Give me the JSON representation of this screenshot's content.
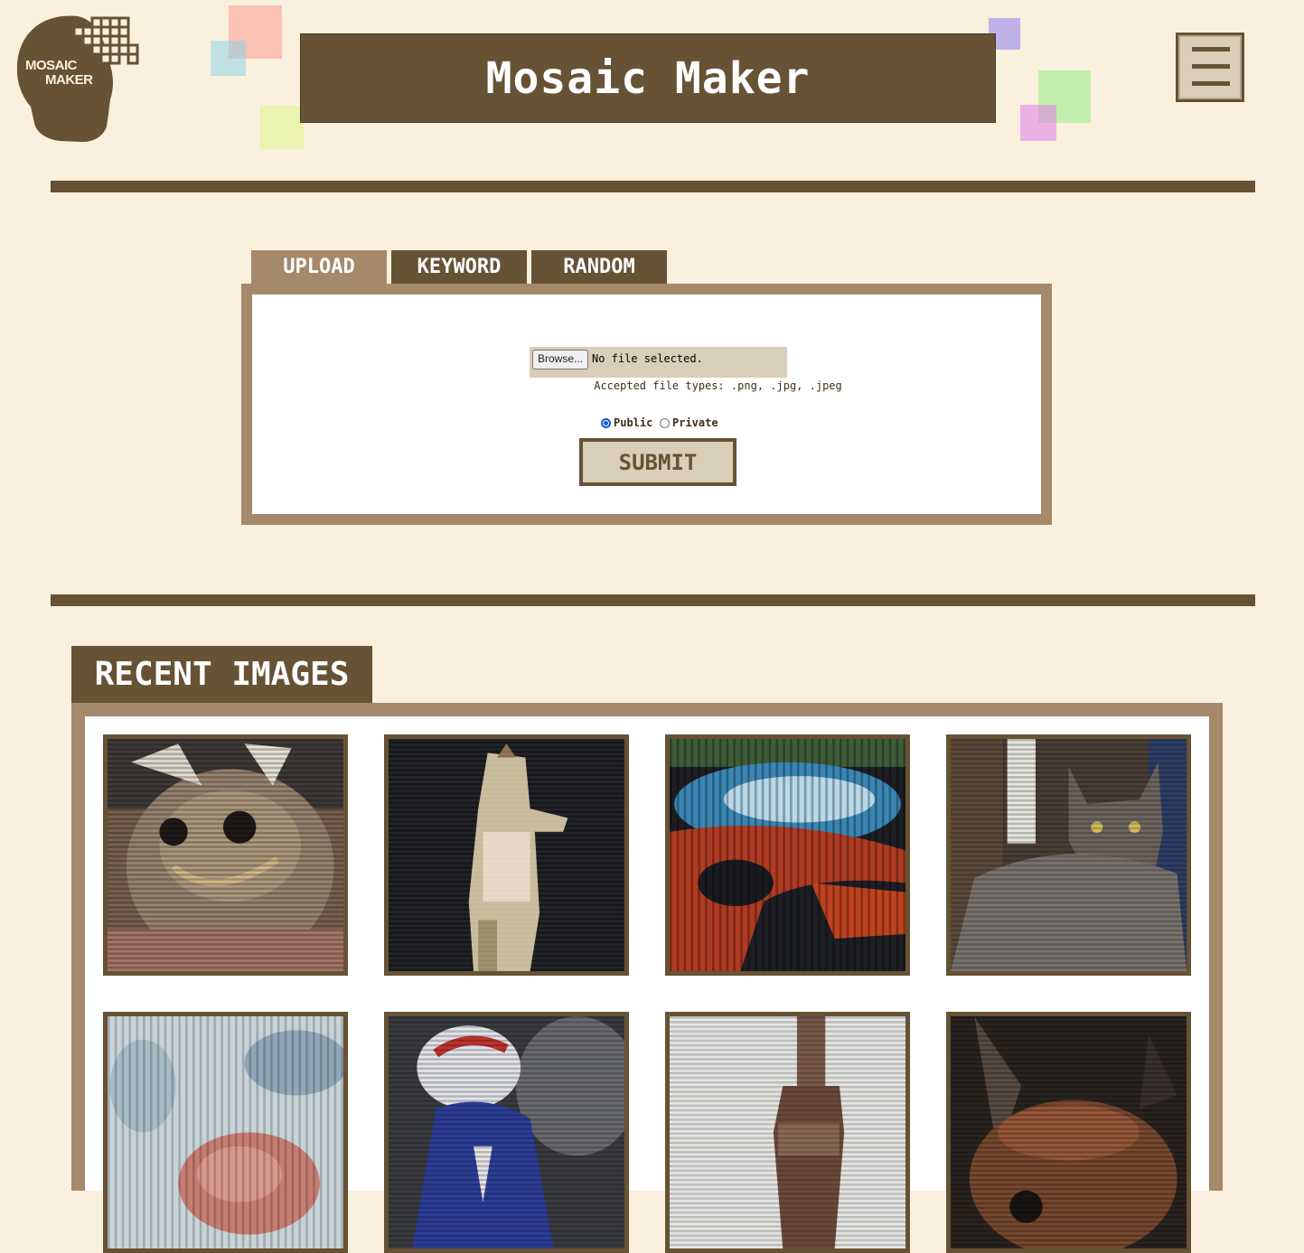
{
  "brand": {
    "logo_line1": "MOSAIC",
    "logo_line2": "MAKER",
    "title": "Mosaic Maker"
  },
  "nav": {
    "menu_icon": "hamburger-menu-icon"
  },
  "upload_section": {
    "tabs": [
      {
        "label": "UPLOAD",
        "active": true
      },
      {
        "label": "KEYWORD",
        "active": false
      },
      {
        "label": "RANDOM",
        "active": false
      }
    ],
    "browse_label": "Browse...",
    "file_status": "No file selected.",
    "accepted_types": "Accepted file types: .png, .jpg, .jpeg",
    "visibility_options": [
      {
        "label": "Public",
        "selected": true
      },
      {
        "label": "Private",
        "selected": false
      }
    ],
    "submit_label": "SUBMIT"
  },
  "recent": {
    "heading": "RECENT IMAGES",
    "images": [
      {
        "subject": "cat-costume-mosaic"
      },
      {
        "subject": "standing-cat-mosaic"
      },
      {
        "subject": "red-car-mosaic"
      },
      {
        "subject": "tabby-cat-mosaic"
      },
      {
        "subject": "flowers-mosaic"
      },
      {
        "subject": "football-player-mosaic"
      },
      {
        "subject": "bottle-mosaic"
      },
      {
        "subject": "dark-cat-mosaic"
      }
    ]
  },
  "colors": {
    "background": "#faf0de",
    "primary_brown": "#675235",
    "tan": "#a5896b",
    "beige_button": "#d9cfb8"
  }
}
